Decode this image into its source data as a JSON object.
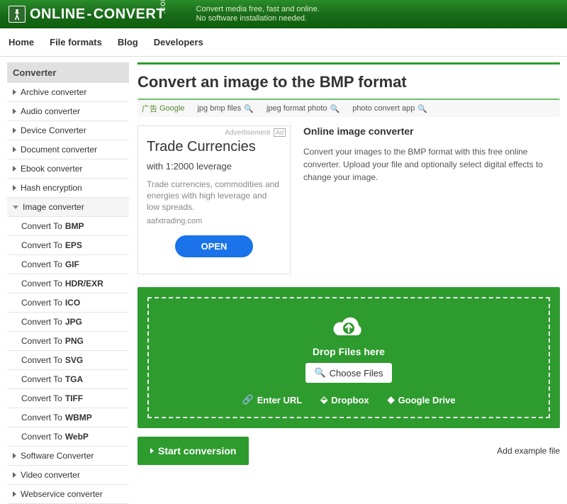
{
  "header": {
    "brand_online": "ONLINE",
    "brand_dash": "-",
    "brand_convert": "CONVERT",
    "brand_com": ".COM",
    "tagline_1": "Convert media free, fast and online.",
    "tagline_2": "No software installation needed."
  },
  "nav": {
    "home": "Home",
    "file_formats": "File formats",
    "blog": "Blog",
    "developers": "Developers"
  },
  "sidebar": {
    "head": "Converter",
    "cats": [
      {
        "label": "Archive converter"
      },
      {
        "label": "Audio converter"
      },
      {
        "label": "Device Converter"
      },
      {
        "label": "Document converter"
      },
      {
        "label": "Ebook converter"
      },
      {
        "label": "Hash encryption"
      }
    ],
    "img_head": "Image converter",
    "img_items": [
      {
        "pre": "Convert To ",
        "fmt": "BMP"
      },
      {
        "pre": "Convert To ",
        "fmt": "EPS"
      },
      {
        "pre": "Convert To ",
        "fmt": "GIF"
      },
      {
        "pre": "Convert To ",
        "fmt": "HDR/EXR"
      },
      {
        "pre": "Convert To ",
        "fmt": "ICO"
      },
      {
        "pre": "Convert To ",
        "fmt": "JPG"
      },
      {
        "pre": "Convert To ",
        "fmt": "PNG"
      },
      {
        "pre": "Convert To ",
        "fmt": "SVG"
      },
      {
        "pre": "Convert To ",
        "fmt": "TGA"
      },
      {
        "pre": "Convert To ",
        "fmt": "TIFF"
      },
      {
        "pre": "Convert To ",
        "fmt": "WBMP"
      },
      {
        "pre": "Convert To ",
        "fmt": "WebP"
      }
    ],
    "tail": [
      {
        "label": "Software Converter"
      },
      {
        "label": "Video converter"
      },
      {
        "label": "Webservice converter"
      }
    ]
  },
  "page_title": "Convert an image to the BMP format",
  "adlinks": {
    "google": "Google",
    "t1": "jpg bmp files",
    "t2": "jpeg format photo",
    "t3": "photo convert app"
  },
  "ad": {
    "label": "Advertisement",
    "pill": "Ad",
    "headline": "Trade Currencies",
    "sub": "with 1:2000 leverage",
    "body": "Trade currencies, commodities and energies with high leverage and low spreads.",
    "domain": "aafxtrading.com",
    "cta": "OPEN"
  },
  "desc": {
    "heading": "Online image converter",
    "body": "Convert your images to the BMP format with this free online converter. Upload your file and optionally select digital effects to change your image."
  },
  "drop": {
    "text": "Drop Files here",
    "choose": "Choose Files",
    "url": "Enter URL",
    "dropbox": "Dropbox",
    "drive": "Google Drive"
  },
  "start": "Start conversion",
  "example": "Add example file"
}
